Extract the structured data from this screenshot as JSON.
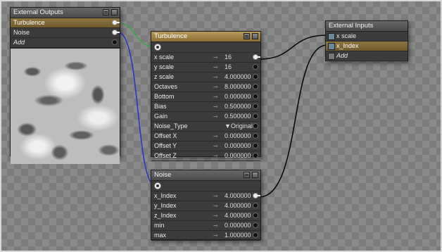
{
  "external_outputs": {
    "title": "External Outputs",
    "rows": [
      {
        "label": "Turbulence"
      },
      {
        "label": "Noise"
      },
      {
        "label": "Add"
      }
    ]
  },
  "turbulence": {
    "title": "Turbulence",
    "rows": [
      {
        "label": "x scale",
        "value": "16"
      },
      {
        "label": "y scale",
        "value": "16"
      },
      {
        "label": "z scale",
        "value": "4.000000"
      },
      {
        "label": "Octaves",
        "value": "8.000000"
      },
      {
        "label": "Bottom",
        "value": "0.000000"
      },
      {
        "label": "Bias",
        "value": "0.500000"
      },
      {
        "label": "Gain",
        "value": "0.500000"
      },
      {
        "label": "Noise_Type",
        "value": "▼Original"
      },
      {
        "label": "Offset X",
        "value": "0.000000"
      },
      {
        "label": "Offset Y",
        "value": "0.000000"
      },
      {
        "label": "Offset Z",
        "value": "0.000000"
      }
    ]
  },
  "noise": {
    "title": "Noise",
    "rows": [
      {
        "label": "x_Index",
        "value": "4.000000"
      },
      {
        "label": "y_Index",
        "value": "4.000000"
      },
      {
        "label": "z_Index",
        "value": "4.000000"
      },
      {
        "label": "min",
        "value": "0.000000"
      },
      {
        "label": "max",
        "value": "1.000000"
      }
    ]
  },
  "external_inputs": {
    "title": "External Inputs",
    "rows": [
      {
        "label": "x scale"
      },
      {
        "label": "x_Index"
      },
      {
        "label": "Add"
      }
    ]
  },
  "colors": {
    "wire_green": "#3fa34d",
    "wire_blue": "#2a36c8",
    "wire_black": "#0a0a0a",
    "selected_row": "#8e7440"
  }
}
